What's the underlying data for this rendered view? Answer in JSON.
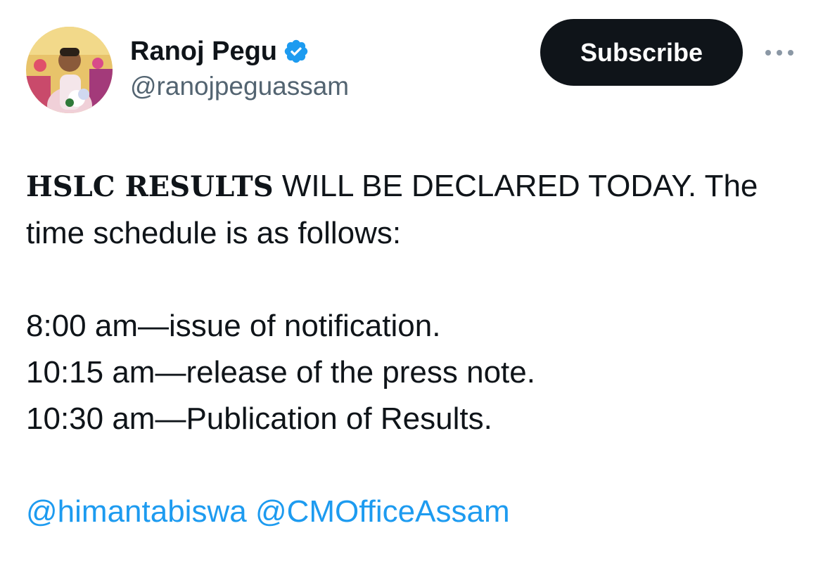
{
  "author": {
    "display_name": "Ranoj Pegu",
    "handle": "@ranojpeguassam",
    "verified_icon": "verified-badge-icon",
    "avatar": "profile-photo"
  },
  "actions": {
    "subscribe_label": "Subscribe",
    "more_icon": "more-options-icon"
  },
  "tweet": {
    "line1_bold": "HSLC RESULTS",
    "line1_rest": " WILL BE DECLARED TODAY. The",
    "line2": "time schedule is as follows:",
    "schedule": [
      "8:00 am—issue of notification.",
      "10:15 am—release of the press note.",
      "10:30 am—Publication of Results."
    ],
    "mentions": [
      "@himantabiswa",
      "@CMOfficeAssam"
    ]
  },
  "colors": {
    "text": "#0f1419",
    "secondary": "#536471",
    "link": "#1d9bf0",
    "button_bg": "#0f1419"
  }
}
